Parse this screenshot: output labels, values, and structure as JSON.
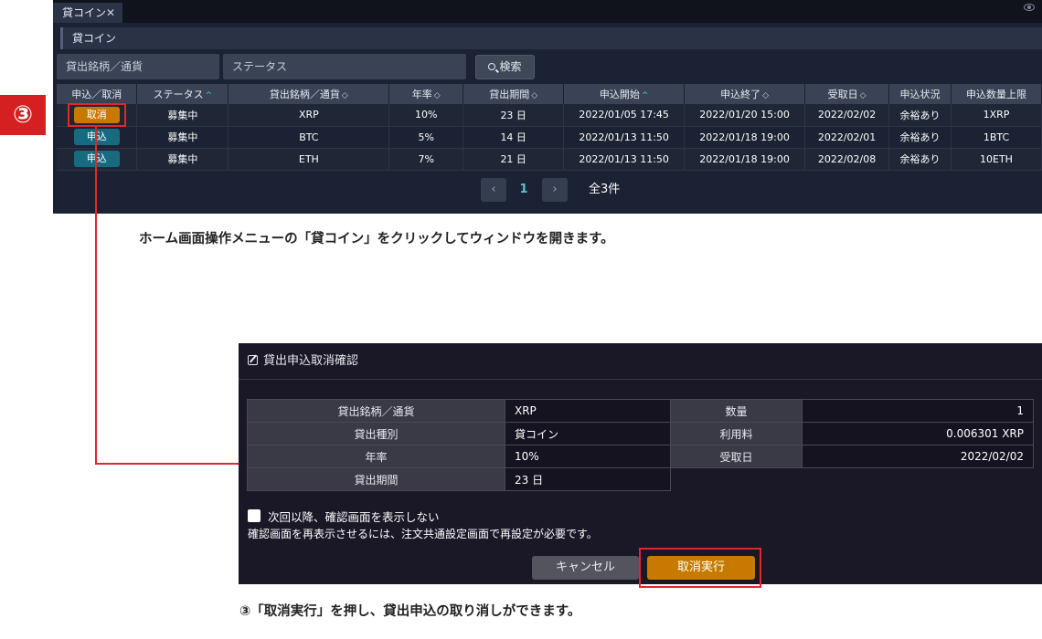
{
  "tab": {
    "label": "貸コイン",
    "close": "✕"
  },
  "panel": {
    "title": "貸コイン"
  },
  "filters": {
    "symbol_placeholder": "貸出銘柄／通貨",
    "status_placeholder": "ステータス",
    "search_label": "検索"
  },
  "table": {
    "headers": [
      {
        "label": "申込／取消",
        "sort": ""
      },
      {
        "label": "ステータス",
        "sort": "^"
      },
      {
        "label": "貸出銘柄／通貨",
        "sort": "◇"
      },
      {
        "label": "年率",
        "sort": "◇"
      },
      {
        "label": "貸出期間",
        "sort": "◇"
      },
      {
        "label": "申込開始",
        "sort": "^"
      },
      {
        "label": "申込終了",
        "sort": "◇"
      },
      {
        "label": "受取日",
        "sort": "◇"
      },
      {
        "label": "申込状況",
        "sort": ""
      },
      {
        "label": "申込数量上限",
        "sort": ""
      }
    ],
    "rows": [
      {
        "action": "取消",
        "status": "募集中",
        "symbol": "XRP",
        "rate": "10%",
        "period": "23 日",
        "start": "2022/01/05 17:45",
        "end": "2022/01/20 15:00",
        "receive": "2022/02/02",
        "state": "余裕あり",
        "limit": "1XRP"
      },
      {
        "action": "申込",
        "status": "募集中",
        "symbol": "BTC",
        "rate": "5%",
        "period": "14 日",
        "start": "2022/01/13 11:50",
        "end": "2022/01/18 19:00",
        "receive": "2022/02/01",
        "state": "余裕あり",
        "limit": "1BTC"
      },
      {
        "action": "申込",
        "status": "募集中",
        "symbol": "ETH",
        "rate": "7%",
        "period": "21 日",
        "start": "2022/01/13 11:50",
        "end": "2022/01/18 19:00",
        "receive": "2022/02/08",
        "state": "余裕あり",
        "limit": "10ETH"
      }
    ]
  },
  "pagination": {
    "prev": "‹",
    "next": "›",
    "current": "1",
    "total": "全3件"
  },
  "step_badge": "③",
  "description1": "ホーム画面操作メニューの「貸コイン」をクリックしてウィンドウを開きます。",
  "dialog": {
    "title": "貸出申込取消確認",
    "labels": {
      "symbol": "貸出銘柄／通貨",
      "type": "貸出種別",
      "rate": "年率",
      "period": "貸出期間",
      "quantity": "数量",
      "fee": "利用料",
      "receive": "受取日"
    },
    "values": {
      "symbol": "XRP",
      "type": "貸コイン",
      "rate": "10%",
      "period": "23 日",
      "quantity": "1",
      "fee": "0.006301 XRP",
      "receive": "2022/02/02"
    },
    "checkbox_label": "次回以降、確認画面を表示しない",
    "note": "確認画面を再表示させるには、注文共通設定画面で再設定が必要です。",
    "cancel_label": "キャンセル",
    "execute_label": "取消実行"
  },
  "description2": "③「取消実行」を押し、貸出申込の取り消しができます。",
  "colors": {
    "accent_orange": "#c87a00",
    "accent_teal": "#176b80",
    "highlight_red": "#e3262b",
    "sort_active": "#56c4d8"
  }
}
